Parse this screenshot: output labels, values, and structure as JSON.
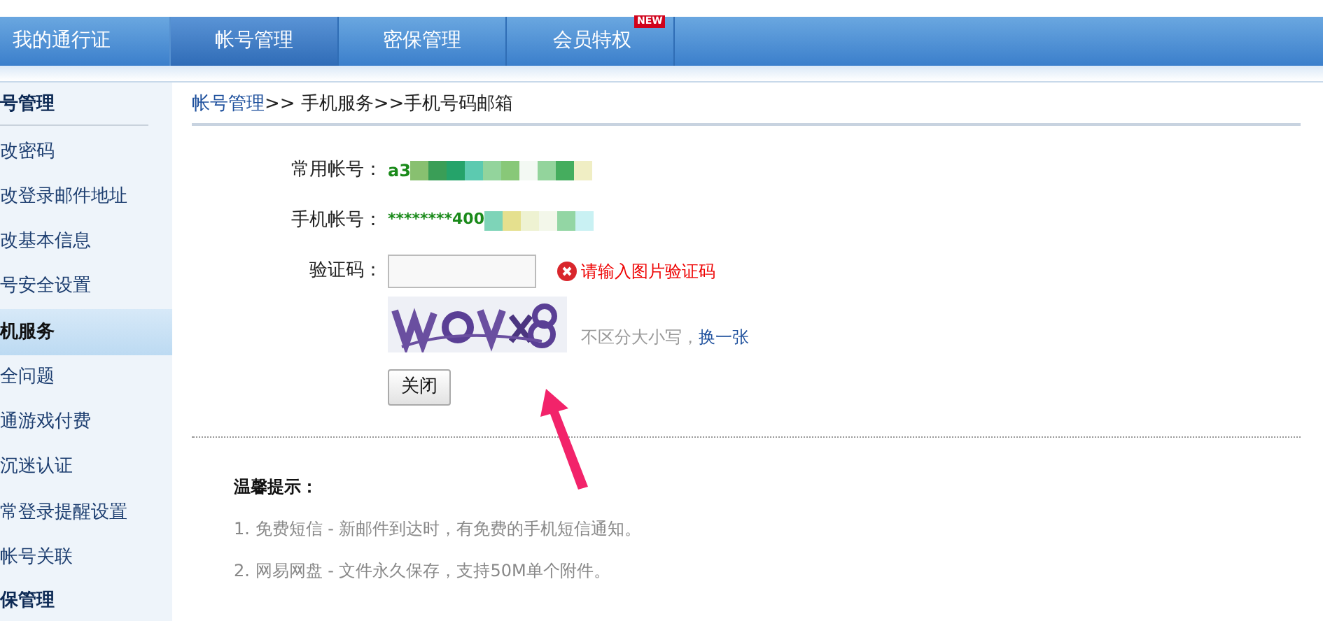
{
  "nav": {
    "home": "我的通行证",
    "tabs": [
      {
        "label": "帐号管理",
        "selected": true
      },
      {
        "label": "密保管理",
        "selected": false
      },
      {
        "label": "会员特权",
        "selected": false,
        "badge": "NEW"
      }
    ]
  },
  "sidebar": {
    "items": [
      {
        "label": "号管理",
        "kind": "heading"
      },
      {
        "label": "改密码",
        "kind": "item",
        "selected": false
      },
      {
        "label": "改登录邮件地址",
        "kind": "item",
        "selected": false
      },
      {
        "label": "改基本信息",
        "kind": "item",
        "selected": false
      },
      {
        "label": "号安全设置",
        "kind": "item",
        "selected": false
      },
      {
        "label": "机服务",
        "kind": "item",
        "selected": true
      },
      {
        "label": "全问题",
        "kind": "item",
        "selected": false
      },
      {
        "label": "通游戏付费",
        "kind": "item",
        "selected": false
      },
      {
        "label": "沉迷认证",
        "kind": "item",
        "selected": false
      },
      {
        "label": "常登录提醒设置",
        "kind": "item",
        "selected": false
      },
      {
        "label": "帐号关联",
        "kind": "item",
        "selected": false
      },
      {
        "label": "保管理",
        "kind": "heading"
      }
    ]
  },
  "breadcrumb": {
    "link": "帐号管理",
    "rest": ">> 手机服务>>手机号码邮箱"
  },
  "form": {
    "account_label": "常用帐号：",
    "account_value": "a3",
    "phone_label": "手机帐号：",
    "phone_value": "********400",
    "captcha_label": "验证码：",
    "error": "请输入图片验证码",
    "hint": "不区分大小写，",
    "refresh_link": "换一张",
    "close_button": "关闭"
  },
  "tips": {
    "title": "温馨提示：",
    "items": [
      "1. 免费短信 - 新邮件到达时，有免费的手机短信通知。",
      "2. 网易网盘 - 文件永久保存，支持50M单个附件。"
    ]
  }
}
